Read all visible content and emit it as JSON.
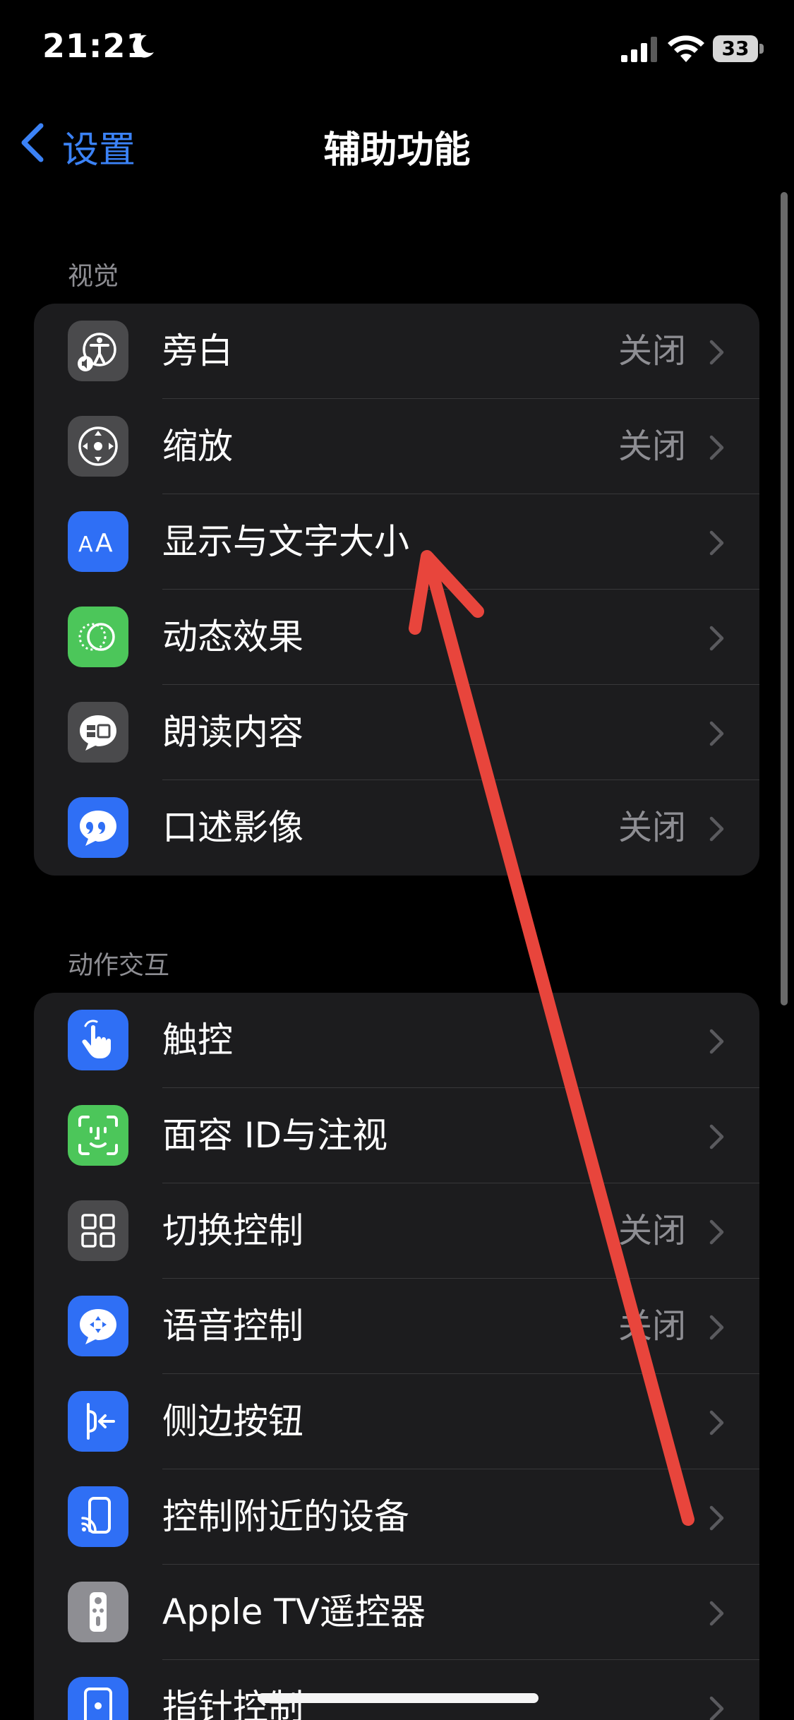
{
  "status_bar": {
    "time": "21:21",
    "battery": "33"
  },
  "nav": {
    "back_label": "设置",
    "title": "辅助功能"
  },
  "sections": [
    {
      "header": "视觉",
      "items": [
        {
          "label": "旁白",
          "value": "关闭",
          "icon": "voiceover-icon",
          "icon_color": "#4a4a4c"
        },
        {
          "label": "缩放",
          "value": "关闭",
          "icon": "zoom-icon",
          "icon_color": "#4a4a4c"
        },
        {
          "label": "显示与文字大小",
          "value": "",
          "icon": "text-size-icon",
          "icon_color": "#2f6ff5"
        },
        {
          "label": "动态效果",
          "value": "",
          "icon": "motion-icon",
          "icon_color": "#4cc65a"
        },
        {
          "label": "朗读内容",
          "value": "",
          "icon": "spoken-content-icon",
          "icon_color": "#4a4a4c"
        },
        {
          "label": "口述影像",
          "value": "关闭",
          "icon": "audio-description-icon",
          "icon_color": "#2f6ff5"
        }
      ]
    },
    {
      "header": "动作交互",
      "items": [
        {
          "label": "触控",
          "value": "",
          "icon": "touch-icon",
          "icon_color": "#2f6ff5"
        },
        {
          "label": "面容 ID与注视",
          "value": "",
          "icon": "face-id-icon",
          "icon_color": "#4cc65a"
        },
        {
          "label": "切换控制",
          "value": "关闭",
          "icon": "switch-control-icon",
          "icon_color": "#4a4a4c"
        },
        {
          "label": "语音控制",
          "value": "关闭",
          "icon": "voice-control-icon",
          "icon_color": "#2f6ff5"
        },
        {
          "label": "侧边按钮",
          "value": "",
          "icon": "side-button-icon",
          "icon_color": "#2f6ff5"
        },
        {
          "label": "控制附近的设备",
          "value": "",
          "icon": "nearby-devices-icon",
          "icon_color": "#2f6ff5"
        },
        {
          "label": "Apple TV遥控器",
          "value": "",
          "icon": "tv-remote-icon",
          "icon_color": "#8e8e93"
        },
        {
          "label": "指针控制",
          "value": "",
          "icon": "pointer-control-icon",
          "icon_color": "#2f6ff5"
        }
      ]
    }
  ],
  "colors": {
    "accent": "#3b82f6",
    "annotation_arrow": "#e8453c"
  }
}
